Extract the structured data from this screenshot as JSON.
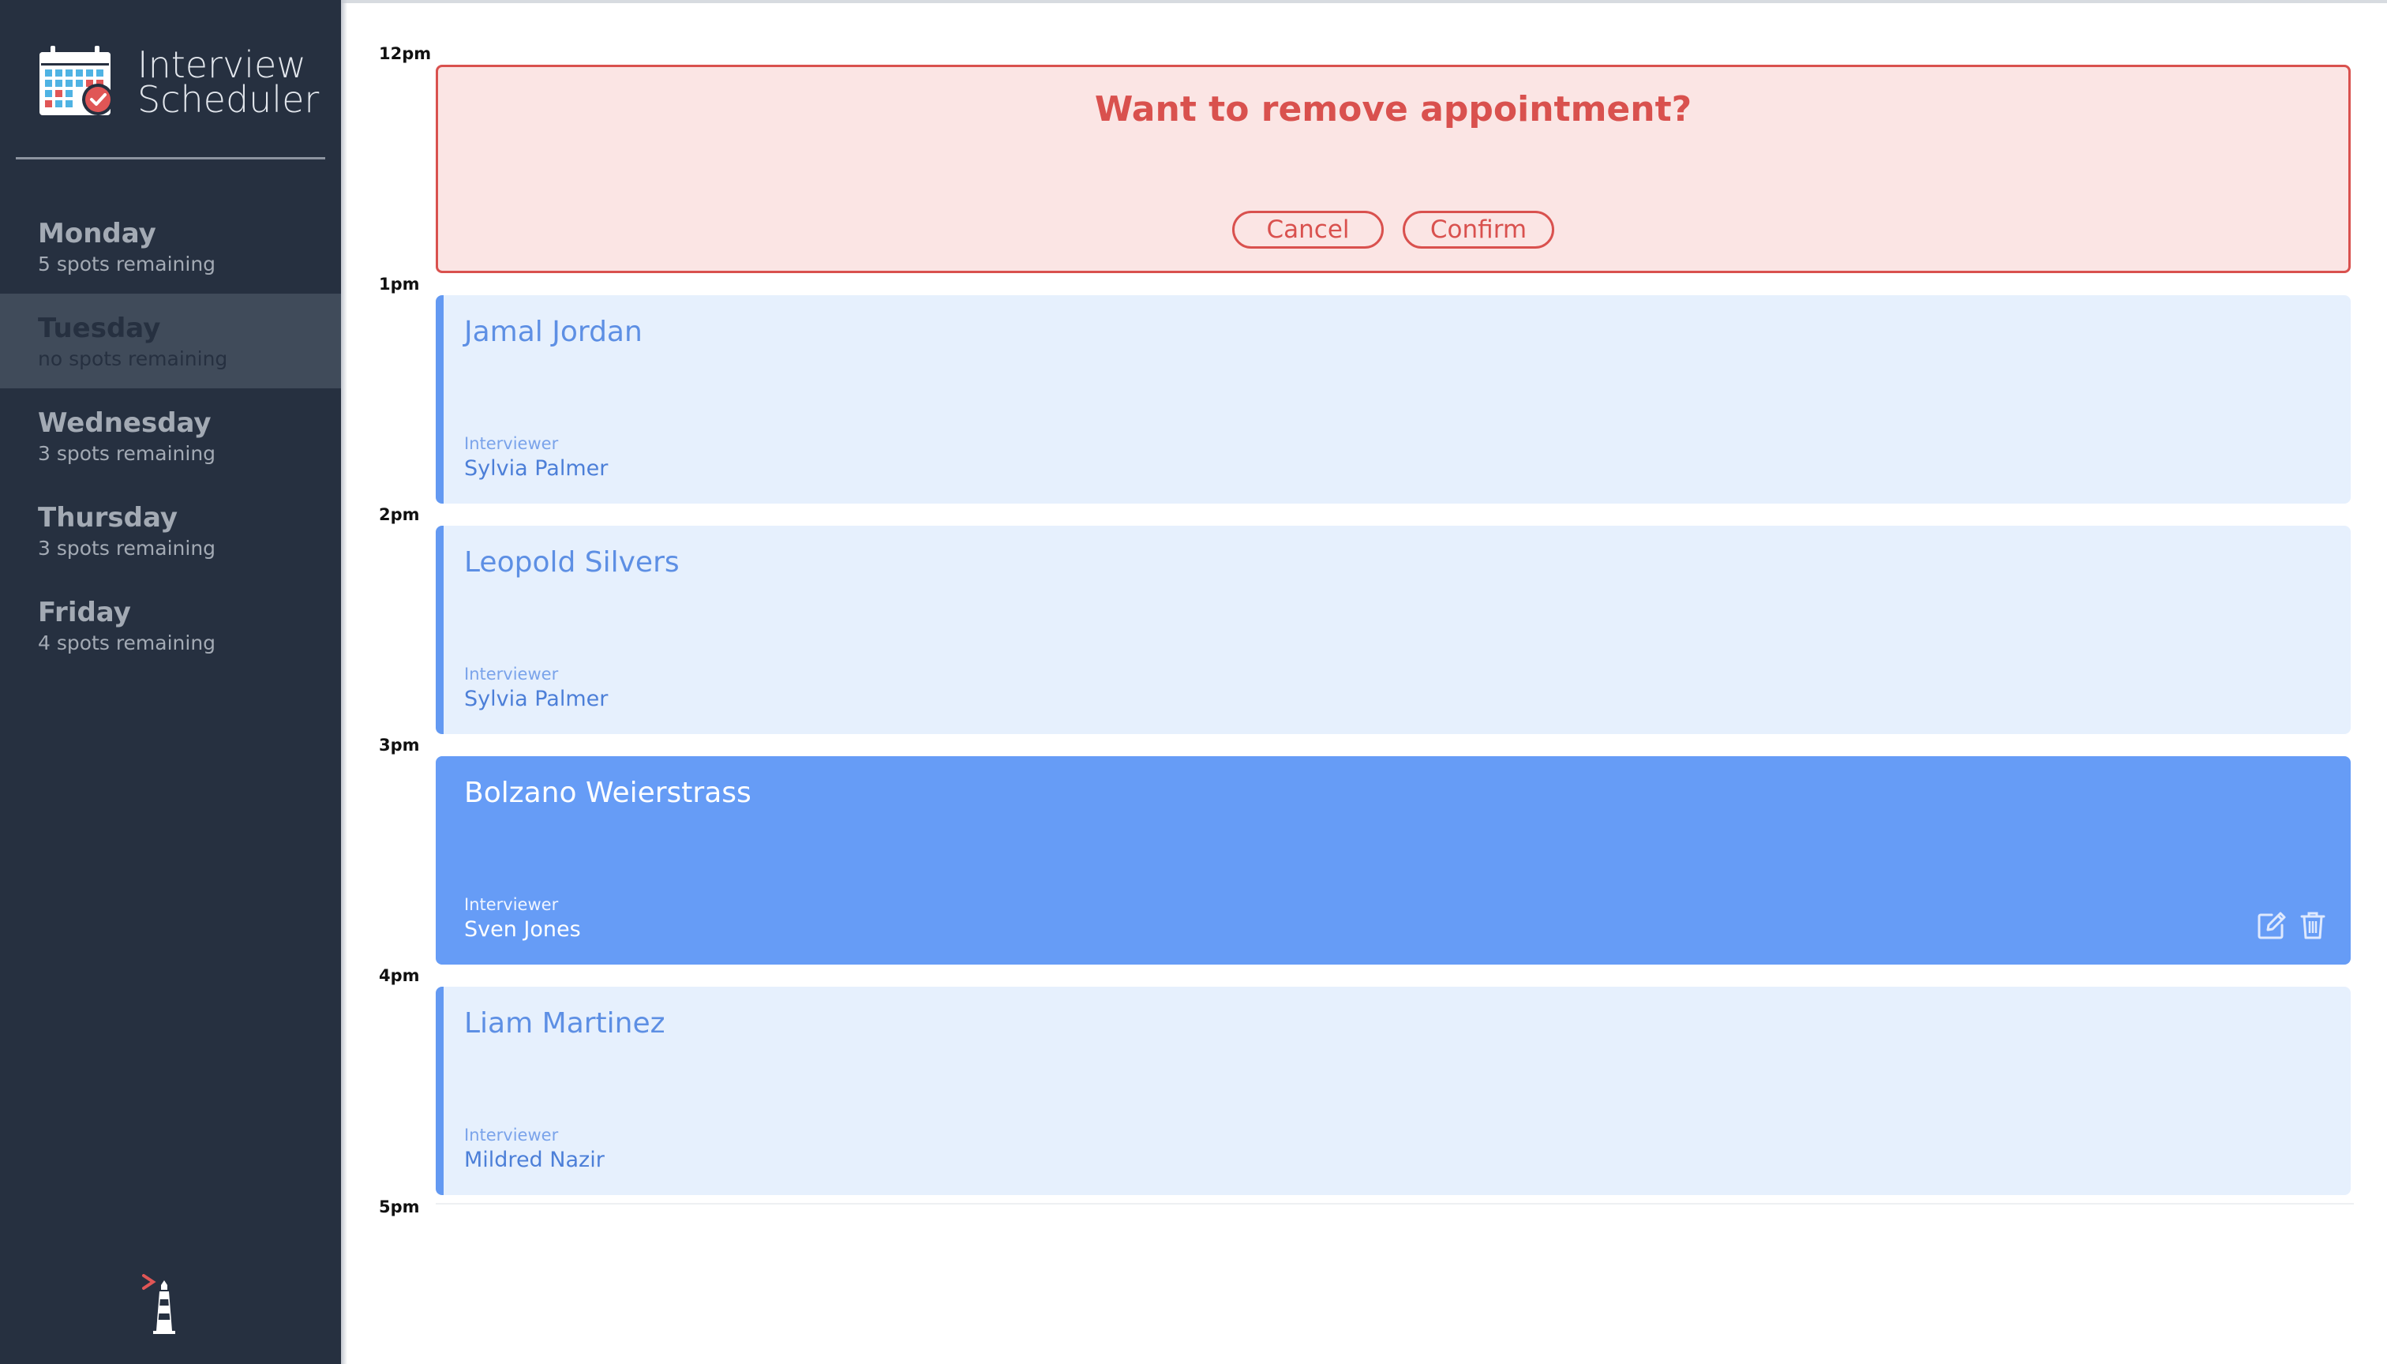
{
  "app": {
    "title_line1": "Interview",
    "title_line2": "Scheduler",
    "brand_icon": "calendar-check-icon",
    "footer_logo": "lighthouse-logo"
  },
  "days": [
    {
      "name": "Monday",
      "spots": "5 spots remaining",
      "selected": false
    },
    {
      "name": "Tuesday",
      "spots": "no spots remaining",
      "selected": true
    },
    {
      "name": "Wednesday",
      "spots": "3 spots remaining",
      "selected": false
    },
    {
      "name": "Thursday",
      "spots": "3 spots remaining",
      "selected": false
    },
    {
      "name": "Friday",
      "spots": "4 spots remaining",
      "selected": false
    }
  ],
  "times": [
    "12pm",
    "1pm",
    "2pm",
    "3pm",
    "4pm",
    "5pm"
  ],
  "confirm": {
    "message": "Want to remove appointment?",
    "cancel_label": "Cancel",
    "confirm_label": "Confirm"
  },
  "appointments": [
    {
      "student": "Jamal Jordan",
      "interviewer_label": "Interviewer",
      "interviewer": "Sylvia Palmer",
      "state": "show"
    },
    {
      "student": "Leopold Silvers",
      "interviewer_label": "Interviewer",
      "interviewer": "Sylvia Palmer",
      "state": "show"
    },
    {
      "student": "Bolzano Weierstrass",
      "interviewer_label": "Interviewer",
      "interviewer": "Sven Jones",
      "state": "hover",
      "actions": [
        "edit-icon",
        "trash-icon"
      ]
    },
    {
      "student": "Liam Martinez",
      "interviewer_label": "Interviewer",
      "interviewer": "Mildred Nazir",
      "state": "show"
    }
  ],
  "colors": {
    "sidebar": "#263040",
    "selected_day": "#404b5a",
    "danger": "#d9514e",
    "danger_bg": "#fbe5e4",
    "appointment_bg": "#e6f0fd",
    "appointment_accent": "#6399f2",
    "appointment_hover": "#669cf6"
  }
}
